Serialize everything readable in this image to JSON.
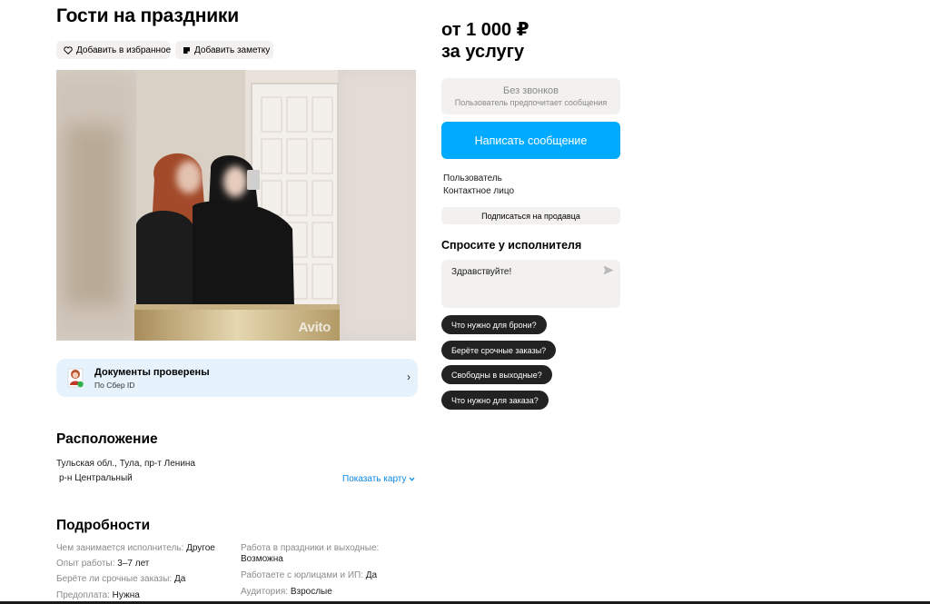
{
  "title": "Гости на праздники",
  "actions": {
    "favorite": "Добавить в избранное",
    "note": "Добавить заметку"
  },
  "gallery": {
    "watermark": "Avito"
  },
  "documents": {
    "title": "Документы проверены",
    "subtitle": "По Сбер ID",
    "arrow": "›"
  },
  "location": {
    "heading": "Расположение",
    "address": "Тульская обл., Тула, пр-т Ленина",
    "district": "р-н Центральный",
    "show_map": "Показать карту"
  },
  "details": {
    "heading": "Подробности",
    "left": [
      {
        "key": "Чем занимается исполнитель:",
        "value": "Другое"
      },
      {
        "key": "Опыт работы:",
        "value": "3–7 лет"
      },
      {
        "key": "Берёте ли срочные заказы:",
        "value": "Да"
      },
      {
        "key": "Предоплата:",
        "value": "Нужна"
      }
    ],
    "right": [
      {
        "key": "Работа в праздники и выходные:",
        "value": "Возможна"
      },
      {
        "key": "Работаете с юрлицами и ИП:",
        "value": "Да"
      },
      {
        "key": "Аудитория:",
        "value": "Взрослые"
      }
    ]
  },
  "price": {
    "line1": "от 1 000 ₽",
    "line2": "за услугу"
  },
  "contact": {
    "no_calls": "Без звонков",
    "no_calls_sub": "Пользователь предпочитает сообщения",
    "write_button": "Написать сообщение",
    "user_role": "Пользователь",
    "user_type": "Контактное лицо",
    "subscribe": "Подписаться на продавца"
  },
  "ask": {
    "heading": "Спросите у исполнителя",
    "message": "Здравствуйте!",
    "questions": [
      "Что нужно для брони?",
      "Берёте срочные заказы?",
      "Свободны в выходные?",
      "Что нужно для заказа?"
    ]
  },
  "colors": {
    "accent": "#00aaff",
    "link": "#0a88e6",
    "chip_bg": "#f2f1ef",
    "docs_bg": "#e6f3fd",
    "question_bg": "#222222"
  }
}
